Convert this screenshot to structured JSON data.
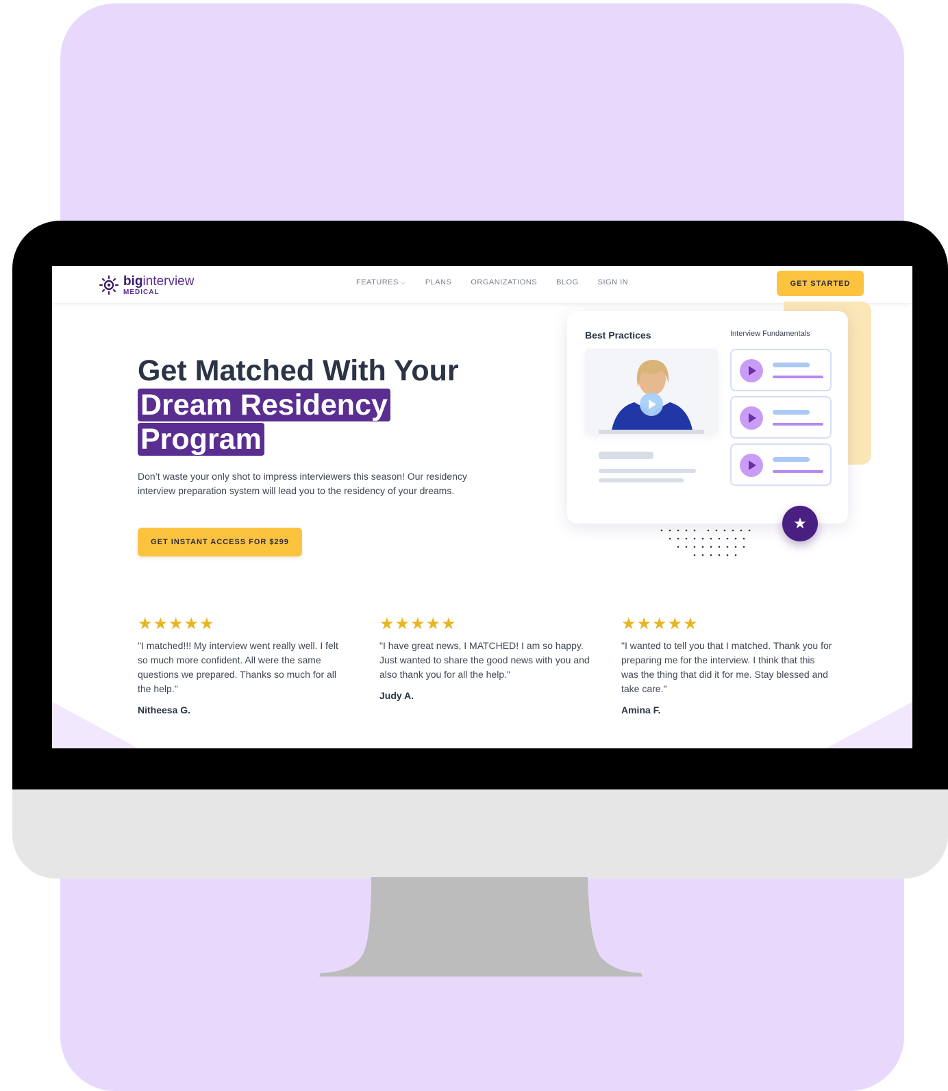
{
  "brand": {
    "logo_main_bold": "big",
    "logo_main_rest": "interview",
    "logo_sub": "MEDICAL",
    "colors": {
      "purple": "#5a2d91",
      "yellow": "#fcc33f",
      "background_lavender": "#e8d9fc"
    }
  },
  "nav": {
    "features": "FEATURES",
    "plans": "PLANS",
    "organizations": "ORGANIZATIONS",
    "blog": "BLOG",
    "sign_in": "SIGN IN",
    "cta": "GET STARTED"
  },
  "hero": {
    "title_line1": "Get Matched With Your",
    "title_highlight1": "Dream Residency",
    "title_highlight2": "Program",
    "description": "Don’t waste your only shot to impress interviewers this season! Our residency interview preparation system will lead you to the residency of your dreams.",
    "cta": "GET INSTANT ACCESS FOR $299"
  },
  "illustration": {
    "title": "Best Practices",
    "subtitle": "Interview Fundamentals",
    "icons": [
      "play-icon",
      "star-icon",
      "chevron-down-icon"
    ]
  },
  "testimonials": [
    {
      "stars": "★★★★★",
      "quote": "\"I matched!!! My interview went really well. I felt so much more confident. All were the same questions we prepared. Thanks so much for all the help.\"",
      "author": "Nitheesa G."
    },
    {
      "stars": "★★★★★",
      "quote": "\"I have great news, I MATCHED! I am so happy. Just wanted to share the good news with you and also thank you for all the help.\"",
      "author": "Judy A."
    },
    {
      "stars": "★★★★★",
      "quote": "\"I wanted to tell you that I matched. Thank you for preparing me for the interview. I think that this was the thing that did it for me. Stay blessed and take care.\"",
      "author": "Amina F."
    }
  ]
}
